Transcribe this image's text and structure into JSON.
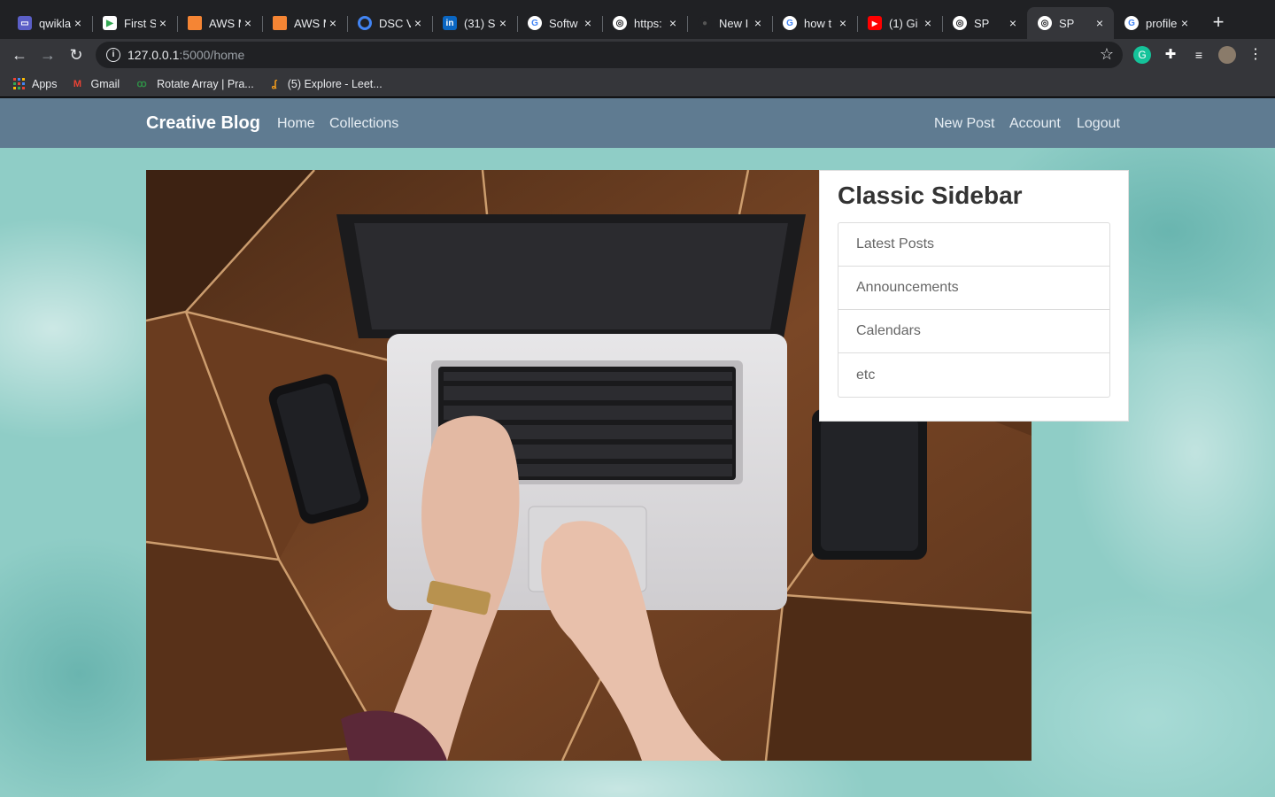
{
  "tabs": [
    {
      "title": "qwikla",
      "favicon": "qwiklabs-icon",
      "color": "#5b5fc7"
    },
    {
      "title": "First S",
      "favicon": "meet-icon",
      "color": "#ffffff"
    },
    {
      "title": "AWS M",
      "favicon": "aws-icon",
      "color": "#f58534"
    },
    {
      "title": "AWS M",
      "favicon": "aws-icon",
      "color": "#f58534"
    },
    {
      "title": "DSC V",
      "favicon": "dsc-icon",
      "color": "#4285f4"
    },
    {
      "title": "(31) S",
      "favicon": "linkedin-icon",
      "color": "#0a66c2"
    },
    {
      "title": "Softw",
      "favicon": "google-icon",
      "color": "#ffffff"
    },
    {
      "title": "https:",
      "favicon": "globe-icon",
      "color": "#ffffff"
    },
    {
      "title": "New I",
      "favicon": "github-icon",
      "color": "#202124"
    },
    {
      "title": "how t",
      "favicon": "google-icon",
      "color": "#ffffff"
    },
    {
      "title": "(1) Gi",
      "favicon": "youtube-icon",
      "color": "#ff0000"
    },
    {
      "title": "SP",
      "favicon": "globe-icon",
      "color": "#ffffff"
    },
    {
      "title": "SP",
      "favicon": "globe-icon",
      "color": "#ffffff",
      "active": true
    },
    {
      "title": "profile",
      "favicon": "google-icon",
      "color": "#ffffff"
    }
  ],
  "address": {
    "host": "127.0.0.1",
    "path": ":5000/home"
  },
  "bookmarks": [
    {
      "label": "Apps",
      "icon": "apps-grid-icon"
    },
    {
      "label": "Gmail",
      "icon": "gmail-icon"
    },
    {
      "label": "Rotate Array | Pra...",
      "icon": "geeksforgeeks-icon"
    },
    {
      "label": "(5) Explore - Leet...",
      "icon": "leetcode-icon"
    }
  ],
  "site": {
    "brand": "Creative Blog",
    "nav_left": [
      "Home",
      "Collections"
    ],
    "nav_right": [
      "New Post",
      "Account",
      "Logout"
    ],
    "nav_color": "#5f7b91"
  },
  "hero": {
    "subject": "Hands typing on a laptop on a wooden table, phone and wallet beside it"
  },
  "sidebar": {
    "title": "Classic Sidebar",
    "items": [
      "Latest Posts",
      "Announcements",
      "Calendars",
      "etc"
    ]
  }
}
